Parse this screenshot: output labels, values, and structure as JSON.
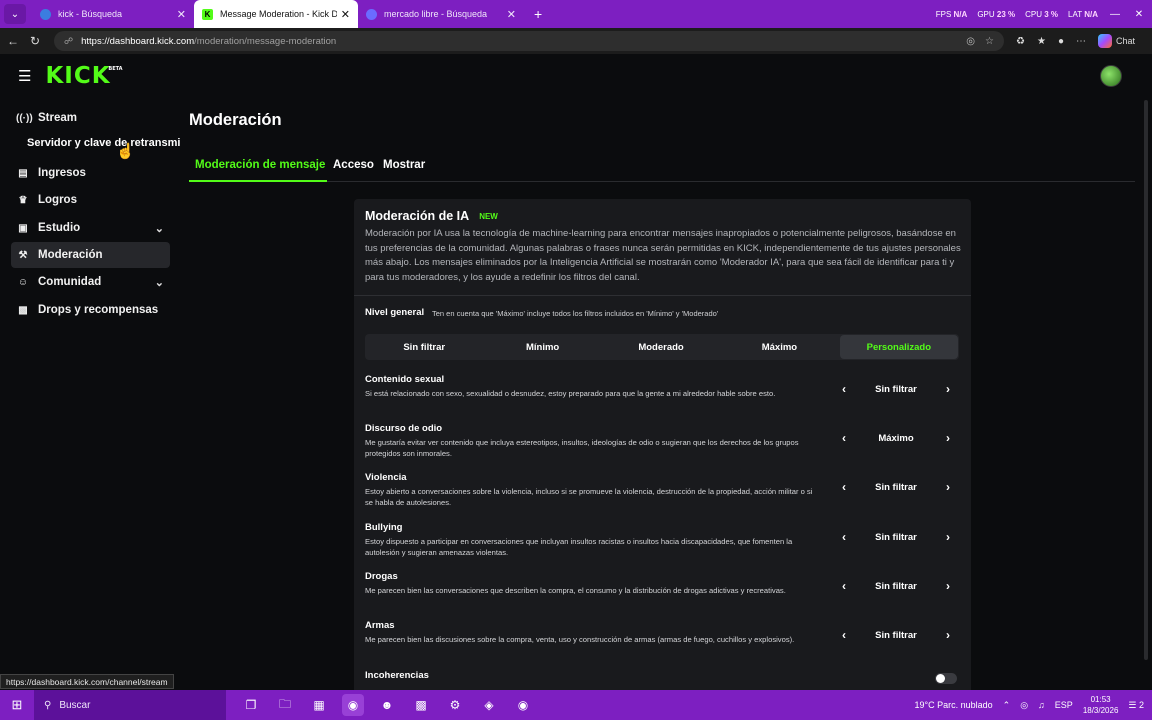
{
  "browser": {
    "tabs": [
      {
        "label": "kick - Búsqueda",
        "favicon": "bing-icon"
      },
      {
        "label": "Message Moderation - Kick Dashb",
        "favicon": "kick-icon"
      },
      {
        "label": "mercado libre - Búsqueda",
        "favicon": "bing-icon"
      }
    ],
    "stats": {
      "fps_label": "FPS",
      "fps_value": "N/A",
      "gpu_label": "GPU",
      "gpu_value": "23 %",
      "cpu_label": "CPU",
      "cpu_value": "3 %",
      "lat_label": "LAT",
      "lat_value": "N/A"
    },
    "url_domain": "https://dashboard.kick.com",
    "url_path": "/moderation/message-moderation",
    "chat_label": "Chat"
  },
  "kick": {
    "logo": "KICK",
    "logo_tag": "BETA"
  },
  "sidebar": {
    "items": [
      {
        "label": "Stream",
        "icon": "broadcast-icon"
      },
      {
        "label": "Ingresos",
        "icon": "chart-icon"
      },
      {
        "label": "Logros",
        "icon": "trophy-icon"
      },
      {
        "label": "Estudio",
        "icon": "studio-icon"
      },
      {
        "label": "Moderación",
        "icon": "wrench-icon"
      },
      {
        "label": "Comunidad",
        "icon": "users-icon"
      },
      {
        "label": "Drops y recompensas",
        "icon": "gift-icon"
      }
    ],
    "sub_item": "Servidor y clave de retransmisión"
  },
  "main": {
    "title": "Moderación",
    "tabs": [
      "Moderación de mensaje",
      "Acceso",
      "Mostrar"
    ]
  },
  "ai_moderation": {
    "title": "Moderación de IA",
    "badge": "NEW",
    "description": "Moderación por IA usa la tecnología de machine-learning para encontrar mensajes inapropiados o potencialmente peligrosos, basándose en tus preferencias de la comunidad. Algunas palabras o frases nunca serán permitidas en KICK, independientemente de tus ajustes personales más abajo. Los mensajes eliminados por la Inteligencia Artificial se mostrarán como 'Moderador IA', para que sea fácil de identificar para ti y para tus moderadores, y los ayude a redefinir los filtros del canal.",
    "level_label": "Nivel general",
    "level_note": "Ten en cuenta que 'Máximo' incluye todos los filtros incluidos en 'Mínimo' y 'Moderado'",
    "levels": [
      "Sin filtrar",
      "Mínimo",
      "Moderado",
      "Máximo",
      "Personalizado"
    ],
    "selected_level": "Personalizado",
    "filters": [
      {
        "name": "Contenido sexual",
        "desc": "Si está relacionado con sexo, sexualidad o desnudez, estoy preparado para que la gente a mi alrededor hable sobre esto.",
        "value": "Sin filtrar"
      },
      {
        "name": "Discurso de odio",
        "desc": "Me gustaría evitar ver contenido que incluya estereotipos, insultos, ideologías de odio o sugieran que los derechos de los grupos protegidos son inmorales.",
        "value": "Máximo"
      },
      {
        "name": "Violencia",
        "desc": "Estoy abierto a conversaciones sobre la violencia, incluso si se promueve la violencia, destrucción de la propiedad, acción militar o si se habla de autolesiones.",
        "value": "Sin filtrar"
      },
      {
        "name": "Bullying",
        "desc": "Estoy dispuesto a participar en conversaciones que incluyan insultos racistas o insultos hacia discapacidades, que fomenten la autolesión y sugieran amenazas violentas.",
        "value": "Sin filtrar"
      },
      {
        "name": "Drogas",
        "desc": "Me parecen bien las conversaciones que describen la compra, el consumo y la distribución de drogas adictivas y recreativas.",
        "value": "Sin filtrar"
      },
      {
        "name": "Armas",
        "desc": "Me parecen bien las discusiones sobre la compra, venta, uso y construcción de armas (armas de fuego, cuchillos y explosivos).",
        "value": "Sin filtrar"
      }
    ],
    "incoherencias": {
      "name": "Incoherencias",
      "enabled": false
    }
  },
  "status_url": "https://dashboard.kick.com/channel/stream",
  "taskbar": {
    "search_label": "Buscar",
    "weather": "19°C  Parc. nublado",
    "lang": "ESP",
    "time": "01:53",
    "date": "18/3/2026",
    "notifications": "2"
  }
}
